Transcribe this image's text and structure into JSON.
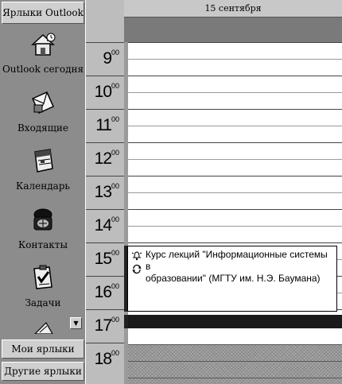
{
  "outlook_bar": {
    "header": "Ярлыки Outlook",
    "shortcuts": [
      {
        "label": "Outlook сегодня",
        "icon": "outlook-today-icon"
      },
      {
        "label": "Входящие",
        "icon": "inbox-icon"
      },
      {
        "label": "Календарь",
        "icon": "calendar-icon"
      },
      {
        "label": "Контакты",
        "icon": "contacts-icon"
      },
      {
        "label": "Задачи",
        "icon": "tasks-icon"
      }
    ],
    "groups": [
      "Мои ярлыки",
      "Другие ярлыки"
    ]
  },
  "calendar": {
    "date_header": "15 сентября",
    "hours": [
      {
        "h": "9",
        "m": "00"
      },
      {
        "h": "10",
        "m": "00"
      },
      {
        "h": "11",
        "m": "00"
      },
      {
        "h": "12",
        "m": "00"
      },
      {
        "h": "13",
        "m": "00"
      },
      {
        "h": "14",
        "m": "00"
      },
      {
        "h": "15",
        "m": "00"
      },
      {
        "h": "16",
        "m": "00"
      },
      {
        "h": "17",
        "m": "00"
      },
      {
        "h": "18",
        "m": "00"
      }
    ],
    "appointment": {
      "line1": "Курс лекций \"Информационные системы в",
      "line2": "образовании\" (МГТУ им. Н.Э. Баумана)",
      "icons": [
        "reminder-bell-icon",
        "recurrence-icon"
      ]
    }
  }
}
